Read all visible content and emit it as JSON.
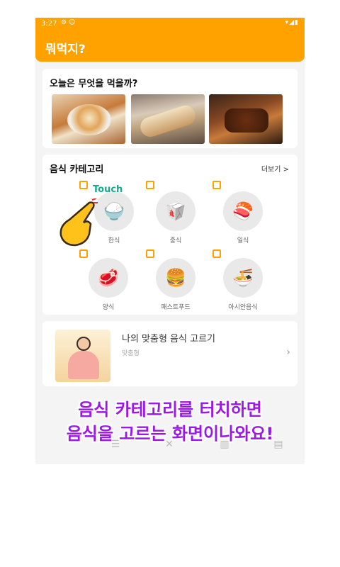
{
  "status_bar": {
    "time": "3:27",
    "left_icons": "⚙ ☺",
    "right_icons": "▾◢▮"
  },
  "app": {
    "title": "뭐먹지?",
    "accent": "#FFA200"
  },
  "today": {
    "title": "오늘은 무엇을 먹을까?"
  },
  "categories": {
    "title": "음식 카테고리",
    "more": "더보기 >",
    "items": [
      {
        "label": "한식",
        "icon": "rice-bowl-icon",
        "glyph": "🍚"
      },
      {
        "label": "중식",
        "icon": "takeout-box-icon",
        "glyph": "🥡"
      },
      {
        "label": "일식",
        "icon": "sushi-icon",
        "glyph": "🍣"
      },
      {
        "label": "양식",
        "icon": "steak-icon",
        "glyph": "🥩"
      },
      {
        "label": "패스트푸드",
        "icon": "burger-fries-icon",
        "glyph": "🍔"
      },
      {
        "label": "아시안음식",
        "icon": "noodle-bowl-icon",
        "glyph": "🍜"
      }
    ]
  },
  "custom": {
    "title": "나의 맞춤형 음식 고르기",
    "subtitle": "맞춤형",
    "arrow": "›"
  },
  "touch_label": "Touch",
  "overlay": {
    "line1": "음식 카테고리를 터치하면",
    "line2": "음식을 고르는 화면이나와요!",
    "color": "#9b19e6"
  },
  "bottom_nav": [
    {
      "icon": "list-icon",
      "glyph": "☰"
    },
    {
      "icon": "shuffle-icon",
      "glyph": "✕"
    },
    {
      "icon": "map-icon",
      "glyph": "▥"
    },
    {
      "icon": "calendar-icon",
      "glyph": "▤"
    }
  ]
}
